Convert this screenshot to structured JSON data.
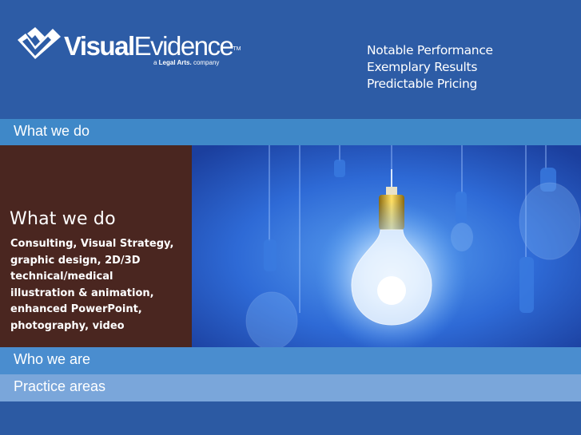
{
  "brand": {
    "name_bold": "Visual",
    "name_light": "Evidence",
    "trademark": "TM",
    "sub_prefix": "a ",
    "sub_brand": "Legal Arts.",
    "sub_suffix": " company",
    "colors": {
      "header_bg": "#2d5ca6",
      "nav_active": "#3f88c8",
      "panel_bg": "#4a2620"
    }
  },
  "taglines": [
    "Notable Performance",
    "Exemplary Results",
    "Predictable Pricing"
  ],
  "nav": {
    "what_we_do": "What we do",
    "who_we_are": "Who we are",
    "practice_areas": "Practice areas"
  },
  "panel": {
    "title": "What we do",
    "lines": [
      "Consulting, Visual Strategy,",
      "graphic design, 2D/3D",
      "technical/medical",
      "illustration & animation,",
      "enhanced PowerPoint,",
      "photography, video"
    ]
  },
  "photo": {
    "subject": "light-bulbs-image"
  }
}
